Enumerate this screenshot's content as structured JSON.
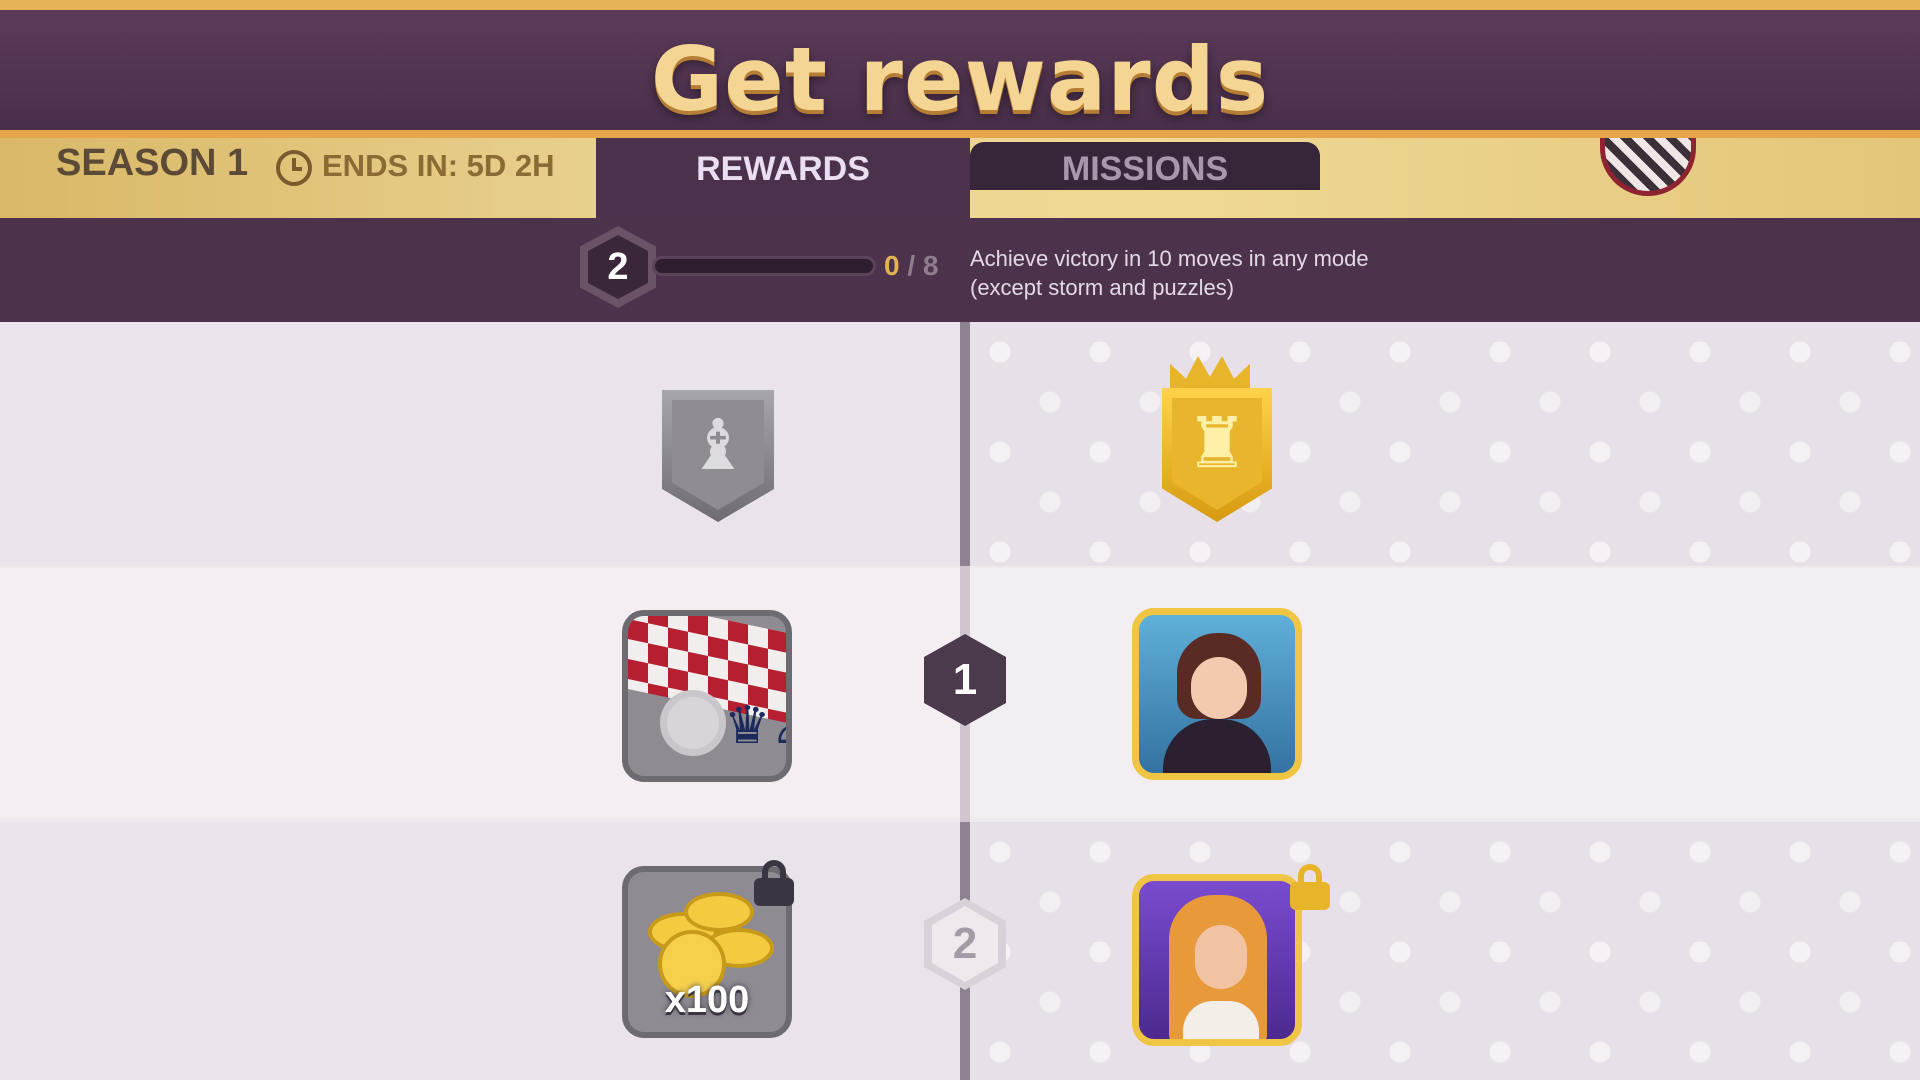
{
  "header": {
    "title": "Get rewards"
  },
  "season": {
    "label": "SEASON 1",
    "ends_in": "ENDS IN: 5D 2H",
    "clock_icon": "clock-icon"
  },
  "tabs": [
    {
      "label": "REWARDS",
      "active": true
    },
    {
      "label": "MISSIONS",
      "active": false
    }
  ],
  "mission": {
    "level": "2",
    "progress_current": "0",
    "progress_separator": "/",
    "progress_total": "8",
    "progress_fraction": 0,
    "description": "Achieve victory in 10 moves in any mode (except storm and puzzles)"
  },
  "tracks": {
    "free": {
      "icon": "silver-pawn-shield-icon"
    },
    "premium": {
      "icon": "gold-king-crown-shield-icon"
    }
  },
  "rewards": [
    {
      "tier": "1",
      "locked": false,
      "free_icon": "chessboard-avatar-icon",
      "premium_icon": "queen-character-portrait"
    },
    {
      "tier": "2",
      "locked": true,
      "free_icon": "coins-icon",
      "free_amount": "x100",
      "premium_icon": "blonde-character-portrait"
    }
  ],
  "colors": {
    "gold": "#e6b25a",
    "header_purple": "#4a2f4a",
    "progress_gold": "#e2b451"
  }
}
